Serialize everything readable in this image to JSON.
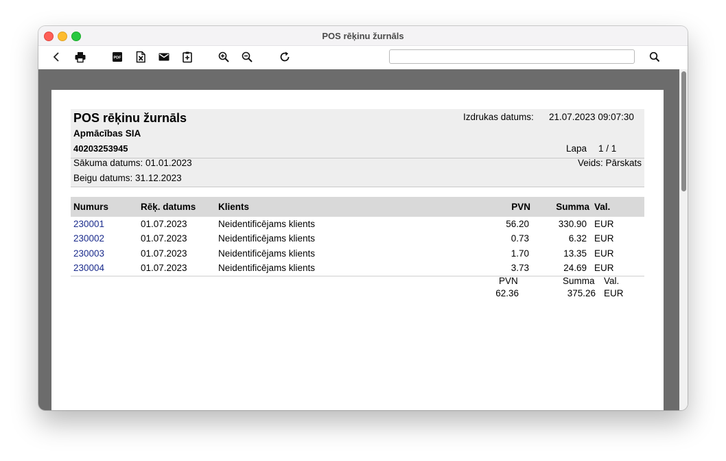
{
  "window": {
    "title": "POS rēķinu žurnāls"
  },
  "toolbar": {
    "icons": [
      "back-icon",
      "print-icon",
      "pdf-icon",
      "excel-export-icon",
      "email-icon",
      "clipboard-icon",
      "zoom-in-icon",
      "zoom-out-icon",
      "refresh-icon",
      "search-icon"
    ],
    "pdf_label": "PDF",
    "search": {
      "value": "",
      "placeholder": ""
    }
  },
  "report": {
    "title": "POS rēķinu žurnāls",
    "company": "Apmācības SIA",
    "reg_number": "40203253945",
    "print_date_label": "Izdrukas datums:",
    "print_date_value": "21.07.2023 09:07:30",
    "page_label": "Lapa",
    "page_value": "1 / 1",
    "start_date": "Sākuma datums: 01.01.2023",
    "end_date": "Beigu datums: 31.12.2023",
    "type": "Veids: Pārskats",
    "columns": {
      "number": "Numurs",
      "date": "Rēķ. datums",
      "client": "Klients",
      "vat": "PVN",
      "sum": "Summa",
      "currency": "Val."
    },
    "rows": [
      {
        "number": "230001",
        "date": "01.07.2023",
        "client": "Neidentificējams klients",
        "vat": "56.20",
        "sum": "330.90",
        "currency": "EUR"
      },
      {
        "number": "230002",
        "date": "01.07.2023",
        "client": "Neidentificējams klients",
        "vat": "0.73",
        "sum": "6.32",
        "currency": "EUR"
      },
      {
        "number": "230003",
        "date": "01.07.2023",
        "client": "Neidentificējams klients",
        "vat": "1.70",
        "sum": "13.35",
        "currency": "EUR"
      },
      {
        "number": "230004",
        "date": "01.07.2023",
        "client": "Neidentificējams klients",
        "vat": "3.73",
        "sum": "24.69",
        "currency": "EUR"
      }
    ],
    "totals": {
      "vat_label": "PVN",
      "sum_label": "Summa",
      "currency_label": "Val.",
      "vat": "62.36",
      "sum": "375.26",
      "currency": "EUR"
    }
  },
  "colors": {
    "link": "#1a2b8c",
    "viewer_bg": "#6c6c6c",
    "header_bg": "#eeeeee",
    "column_header_bg": "#d9d9d9"
  }
}
